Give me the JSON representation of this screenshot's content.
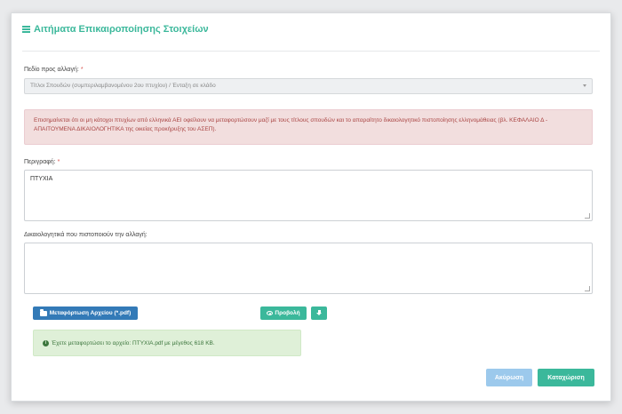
{
  "header": {
    "title": "Αιτήματα Επικαιροποίησης Στοιχείων",
    "icon": "list-icon"
  },
  "form": {
    "field_label": "Πεδίο προς αλλαγή:",
    "required_mark": "*",
    "field_value": "Τίτλοι Σπουδών (συμπεριλαμβανομένου 2ου πτυχίου) / Ένταξη σε κλάδο",
    "warning": "Επισημαίνεται ότι οι μη κάτοχοι πτυχίων από ελληνικά ΑΕΙ οφείλουν να μεταφορτώσουν μαζί με τους τίτλους σπουδών και το απαραίτητο δικαιολογητικό πιστοποίησης ελληνομάθειας (βλ. ΚΕΦΑΛΑΙΟ Δ - ΑΠΑΙΤΟΥΜΕΝΑ ΔΙΚΑΙΟΛΟΓΗΤΙΚΑ της οικείας προκήρυξης του ΑΣΕΠ).",
    "description_label": "Περιγραφή:",
    "description_value": "ΠΤΥΧΙΑ",
    "documents_label": "Δικαιολογητικά που πιστοποιούν την αλλαγή:",
    "documents_value": ""
  },
  "buttons": {
    "upload": "Μεταφόρτωση Αρχείου (*.pdf)",
    "view": "Προβολή",
    "cancel": "Ακύρωση",
    "save": "Καταχώριση"
  },
  "upload_status": "Έχετε μεταφορτώσει το αρχείο: ΠΤΥΧΙΑ.pdf με μέγεθος 618 KB.",
  "colors": {
    "accent": "#3bb89b",
    "primary": "#337ab7",
    "danger_bg": "#f2dede",
    "success_bg": "#dff0d8"
  }
}
